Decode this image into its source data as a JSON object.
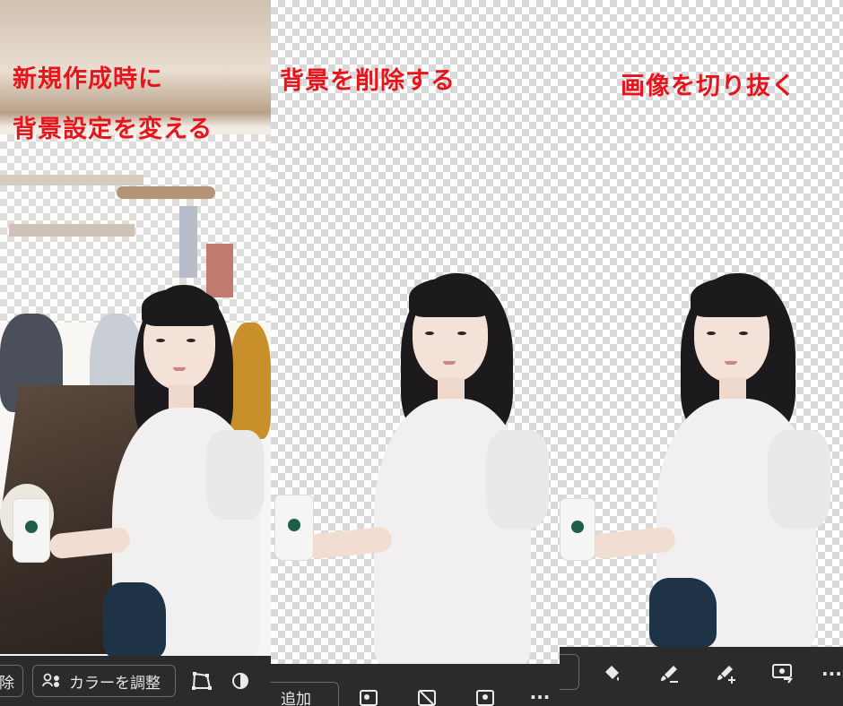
{
  "captions": {
    "panel1_line1": "新規作成時に",
    "panel1_line2": "背景設定を変える",
    "panel2": "背景を削除する",
    "panel3": "画像を切り抜く"
  },
  "toolbar1": {
    "remove_partial": "除",
    "adjust_color_label": "カラーを調整"
  },
  "toolbar2": {
    "add_partial": "追加",
    "more_label": "···"
  },
  "toolbar3": {
    "more_label": "···"
  },
  "colors": {
    "caption": "#e8141b",
    "toolbar_bg": "#2b2b2b",
    "checker_dark": "#d9d9d9"
  },
  "icons": {
    "toolbar1": [
      "person-color-icon",
      "crop-shape-icon",
      "contrast-icon"
    ],
    "toolbar2": [
      "image-plus-icon",
      "image-off-icon",
      "image-person-icon",
      "more-icon"
    ],
    "toolbar3": [
      "paint-bucket-icon",
      "brush-icon",
      "brush-plus-icon",
      "image-select-icon",
      "more-icon"
    ]
  }
}
